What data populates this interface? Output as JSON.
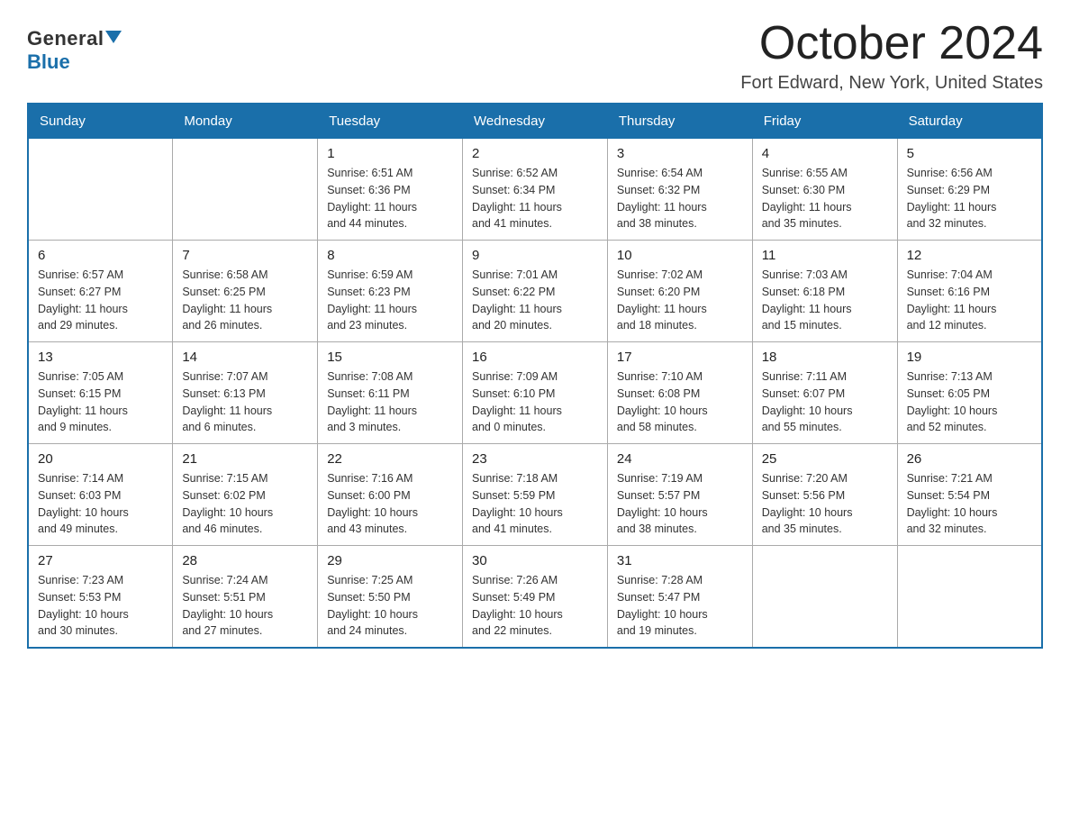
{
  "header": {
    "logo_general": "General",
    "logo_blue": "Blue",
    "month_title": "October 2024",
    "location": "Fort Edward, New York, United States"
  },
  "days_of_week": [
    "Sunday",
    "Monday",
    "Tuesday",
    "Wednesday",
    "Thursday",
    "Friday",
    "Saturday"
  ],
  "weeks": [
    [
      {
        "day": "",
        "info": ""
      },
      {
        "day": "",
        "info": ""
      },
      {
        "day": "1",
        "info": "Sunrise: 6:51 AM\nSunset: 6:36 PM\nDaylight: 11 hours\nand 44 minutes."
      },
      {
        "day": "2",
        "info": "Sunrise: 6:52 AM\nSunset: 6:34 PM\nDaylight: 11 hours\nand 41 minutes."
      },
      {
        "day": "3",
        "info": "Sunrise: 6:54 AM\nSunset: 6:32 PM\nDaylight: 11 hours\nand 38 minutes."
      },
      {
        "day": "4",
        "info": "Sunrise: 6:55 AM\nSunset: 6:30 PM\nDaylight: 11 hours\nand 35 minutes."
      },
      {
        "day": "5",
        "info": "Sunrise: 6:56 AM\nSunset: 6:29 PM\nDaylight: 11 hours\nand 32 minutes."
      }
    ],
    [
      {
        "day": "6",
        "info": "Sunrise: 6:57 AM\nSunset: 6:27 PM\nDaylight: 11 hours\nand 29 minutes."
      },
      {
        "day": "7",
        "info": "Sunrise: 6:58 AM\nSunset: 6:25 PM\nDaylight: 11 hours\nand 26 minutes."
      },
      {
        "day": "8",
        "info": "Sunrise: 6:59 AM\nSunset: 6:23 PM\nDaylight: 11 hours\nand 23 minutes."
      },
      {
        "day": "9",
        "info": "Sunrise: 7:01 AM\nSunset: 6:22 PM\nDaylight: 11 hours\nand 20 minutes."
      },
      {
        "day": "10",
        "info": "Sunrise: 7:02 AM\nSunset: 6:20 PM\nDaylight: 11 hours\nand 18 minutes."
      },
      {
        "day": "11",
        "info": "Sunrise: 7:03 AM\nSunset: 6:18 PM\nDaylight: 11 hours\nand 15 minutes."
      },
      {
        "day": "12",
        "info": "Sunrise: 7:04 AM\nSunset: 6:16 PM\nDaylight: 11 hours\nand 12 minutes."
      }
    ],
    [
      {
        "day": "13",
        "info": "Sunrise: 7:05 AM\nSunset: 6:15 PM\nDaylight: 11 hours\nand 9 minutes."
      },
      {
        "day": "14",
        "info": "Sunrise: 7:07 AM\nSunset: 6:13 PM\nDaylight: 11 hours\nand 6 minutes."
      },
      {
        "day": "15",
        "info": "Sunrise: 7:08 AM\nSunset: 6:11 PM\nDaylight: 11 hours\nand 3 minutes."
      },
      {
        "day": "16",
        "info": "Sunrise: 7:09 AM\nSunset: 6:10 PM\nDaylight: 11 hours\nand 0 minutes."
      },
      {
        "day": "17",
        "info": "Sunrise: 7:10 AM\nSunset: 6:08 PM\nDaylight: 10 hours\nand 58 minutes."
      },
      {
        "day": "18",
        "info": "Sunrise: 7:11 AM\nSunset: 6:07 PM\nDaylight: 10 hours\nand 55 minutes."
      },
      {
        "day": "19",
        "info": "Sunrise: 7:13 AM\nSunset: 6:05 PM\nDaylight: 10 hours\nand 52 minutes."
      }
    ],
    [
      {
        "day": "20",
        "info": "Sunrise: 7:14 AM\nSunset: 6:03 PM\nDaylight: 10 hours\nand 49 minutes."
      },
      {
        "day": "21",
        "info": "Sunrise: 7:15 AM\nSunset: 6:02 PM\nDaylight: 10 hours\nand 46 minutes."
      },
      {
        "day": "22",
        "info": "Sunrise: 7:16 AM\nSunset: 6:00 PM\nDaylight: 10 hours\nand 43 minutes."
      },
      {
        "day": "23",
        "info": "Sunrise: 7:18 AM\nSunset: 5:59 PM\nDaylight: 10 hours\nand 41 minutes."
      },
      {
        "day": "24",
        "info": "Sunrise: 7:19 AM\nSunset: 5:57 PM\nDaylight: 10 hours\nand 38 minutes."
      },
      {
        "day": "25",
        "info": "Sunrise: 7:20 AM\nSunset: 5:56 PM\nDaylight: 10 hours\nand 35 minutes."
      },
      {
        "day": "26",
        "info": "Sunrise: 7:21 AM\nSunset: 5:54 PM\nDaylight: 10 hours\nand 32 minutes."
      }
    ],
    [
      {
        "day": "27",
        "info": "Sunrise: 7:23 AM\nSunset: 5:53 PM\nDaylight: 10 hours\nand 30 minutes."
      },
      {
        "day": "28",
        "info": "Sunrise: 7:24 AM\nSunset: 5:51 PM\nDaylight: 10 hours\nand 27 minutes."
      },
      {
        "day": "29",
        "info": "Sunrise: 7:25 AM\nSunset: 5:50 PM\nDaylight: 10 hours\nand 24 minutes."
      },
      {
        "day": "30",
        "info": "Sunrise: 7:26 AM\nSunset: 5:49 PM\nDaylight: 10 hours\nand 22 minutes."
      },
      {
        "day": "31",
        "info": "Sunrise: 7:28 AM\nSunset: 5:47 PM\nDaylight: 10 hours\nand 19 minutes."
      },
      {
        "day": "",
        "info": ""
      },
      {
        "day": "",
        "info": ""
      }
    ]
  ]
}
